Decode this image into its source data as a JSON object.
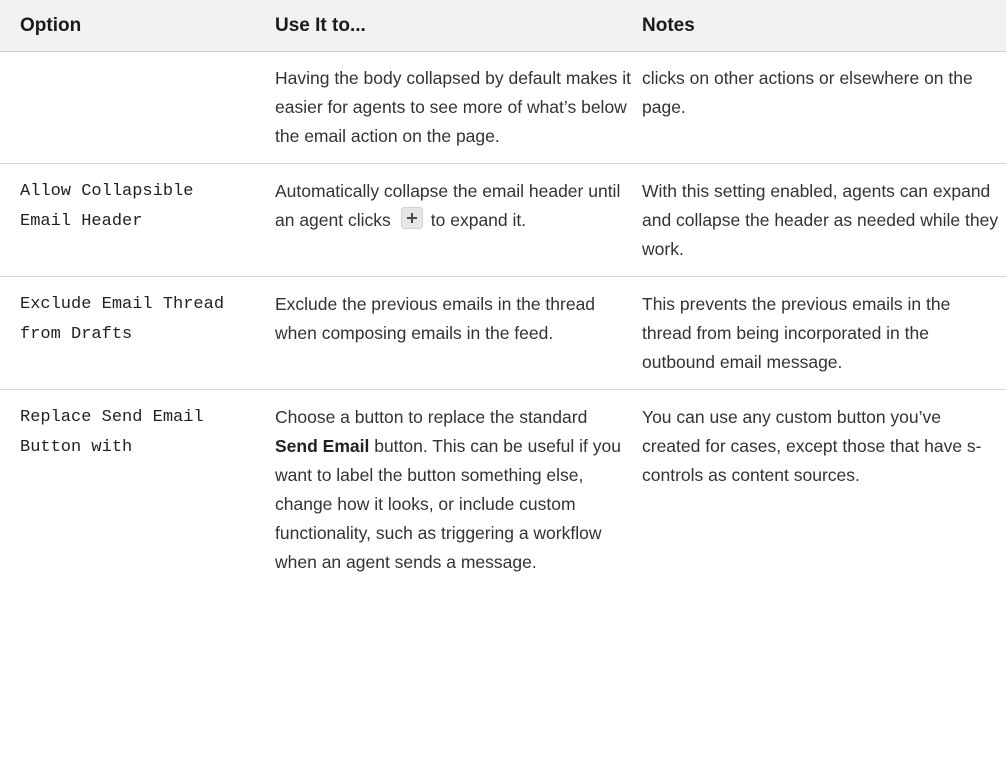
{
  "table": {
    "headers": {
      "option": "Option",
      "use": "Use It to...",
      "notes": "Notes"
    },
    "continued_row": {
      "option": "",
      "use": "Having the body collapsed by default makes it easier for agents to see more of what’s below the email action on the page.",
      "notes": "clicks on other actions or elsewhere on the page."
    },
    "row_header": {
      "option": "Allow Collapsible Email Header",
      "use_before": "Automatically collapse the email header until an agent clicks",
      "icon": "plus-icon",
      "use_after": "to expand it.",
      "notes": "With this setting enabled, agents can expand and collapse the header as needed while they work."
    },
    "row_thread": {
      "option": "Exclude Email Thread from Drafts",
      "use": "Exclude the previous emails in the thread when composing emails in the feed.",
      "notes": "This prevents the previous emails in the thread from being incorporated in the outbound email message."
    },
    "row_send": {
      "option": "Replace Send Email Button with",
      "use_before": "Choose a button to replace the standard",
      "use_bold": "Send Email",
      "use_after": "button. This can be useful if you want to label the button something else, change how it looks, or include custom functionality, such as triggering a workflow when an agent sends a message.",
      "notes": "You can use any custom button you’ve created for cases, except those that have s-controls as content sources."
    }
  }
}
